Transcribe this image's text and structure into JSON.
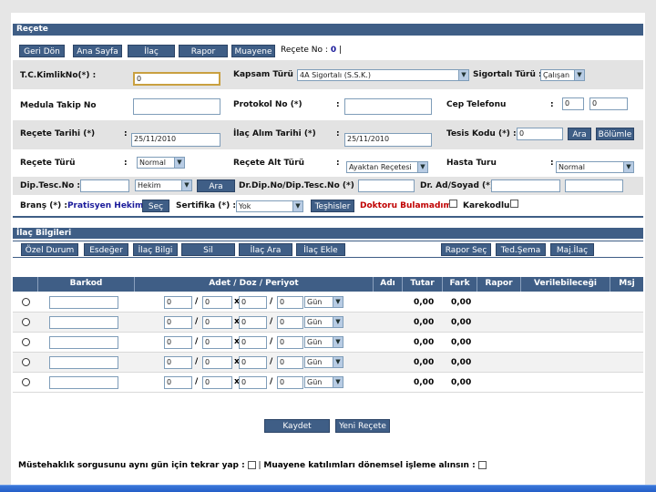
{
  "header": {
    "title": "Reçete"
  },
  "toolbar": {
    "geri_don": "Geri Dön",
    "ana_sayfa": "Ana Sayfa",
    "ilac": "İlaç",
    "rapor": "Rapor",
    "muayene": "Muayene",
    "recete_no_label": "Reçete No :",
    "recete_no_value": "0",
    "recete_no_suffix": "|"
  },
  "form": {
    "tc_label": "T.C.KimlikNo(*) :",
    "tc_value": "0",
    "kapsam_label": "Kapsam Türü :",
    "kapsam_value": "4A Sigortalı (S.S.K.)",
    "sigortali_label": "Sigortalı Türü :",
    "sigortali_value": "Çalışan",
    "medula_label": "Medula Takip No",
    "medula_value": "",
    "protokol_label": "Protokol No (*)",
    "protokol_value": "",
    "cep_label": "Cep Telefonu",
    "cep_value1": "0",
    "cep_value2": "0",
    "recete_tarihi_label": "Reçete Tarihi (*)",
    "recete_tarihi_value": "25/11/2010",
    "ilac_alim_label": "İlaç Alım Tarihi (*)",
    "ilac_alim_value": "25/11/2010",
    "tesis_label": "Tesis Kodu (*) :",
    "tesis_value": "0",
    "ara_label": "Ara",
    "bolumler_label": "Bölümle",
    "recete_turu_label": "Reçete Türü",
    "recete_turu_value": "Normal",
    "alt_turu_label": "Reçete Alt Türü",
    "alt_turu_value": "Ayaktan Reçetesi",
    "hasta_turu_label": "Hasta Turu",
    "hasta_turu_value": "Normal",
    "dip_tesc_label": "Dip.Tesc.No :",
    "dip_tesc_value": "",
    "hekim_value": "Hekim",
    "ara2_label": "Ara",
    "dr_dip_label": "Dr.Dip.No/Dip.Tesc.No (*) :",
    "dr_dip_value": "",
    "dr_ad_label": "Dr. Ad/Soyad (*) :",
    "dr_ad_value1": "",
    "dr_ad_value2": "",
    "brans_label": "Branş (*) :",
    "brans_value": "Pratisyen Hekim",
    "sec_label": "Seç",
    "sertifika_label": "Sertifika (*) :",
    "sertifika_value": "Yok",
    "teshisler_label": "Teşhisler",
    "doktoru_bulamadim": "Doktoru Bulamadım",
    "karekodlu_label": "Karekodlu"
  },
  "ilac_bilgileri": {
    "title": "İlaç Bilgileri",
    "buttons": [
      "Özel Durum",
      "Esdeğer",
      "İlaç Bilgi",
      "Sil",
      "İlaç Ara",
      "İlaç Ekle"
    ],
    "right_buttons": [
      "Rapor Seç",
      "Ted.Şema",
      "Maj.İlaç"
    ]
  },
  "table": {
    "headers": {
      "barkod": "Barkod",
      "adet": "Adet / Doz / Periyot",
      "adi": "Adı",
      "tutar": "Tutar",
      "fark": "Fark",
      "rapor": "Rapor",
      "verilebilecegi": "Verilebileceği",
      "msj": "Msj"
    },
    "rows": [
      {
        "adet": "0",
        "doz1": "0",
        "x": "x",
        "doz2": "0",
        "period": "0",
        "unit": "Gün",
        "tutar": "0,00",
        "fark": "0,00"
      },
      {
        "adet": "0",
        "doz1": "0",
        "x": "x",
        "doz2": "0",
        "period": "0",
        "unit": "Gün",
        "tutar": "0,00",
        "fark": "0,00"
      },
      {
        "adet": "0",
        "doz1": "0",
        "x": "x",
        "doz2": "0",
        "period": "0",
        "unit": "Gün",
        "tutar": "0,00",
        "fark": "0,00"
      },
      {
        "adet": "0",
        "doz1": "0",
        "x": "x",
        "doz2": "0",
        "period": "0",
        "unit": "Gün",
        "tutar": "0,00",
        "fark": "0,00"
      },
      {
        "adet": "0",
        "doz1": "0",
        "x": "x",
        "doz2": "0",
        "period": "0",
        "unit": "Gün",
        "tutar": "0,00",
        "fark": "0,00"
      }
    ],
    "slash": "/"
  },
  "actions": {
    "kaydet": "Kaydet",
    "yeni_recete": "Yeni Reçete"
  },
  "footer": {
    "mustehaklik": "Müstehaklık sorgusunu aynı gün için tekrar yap :",
    "separator": "|",
    "muayene_katilim": "Muayene katılımları dönemsel işleme alınsın :"
  },
  "colors": {
    "accent": "#3f5e86",
    "alt_row": "#e3e3e3",
    "warning": "#c00000",
    "link_blue": "#1a1a9a"
  }
}
